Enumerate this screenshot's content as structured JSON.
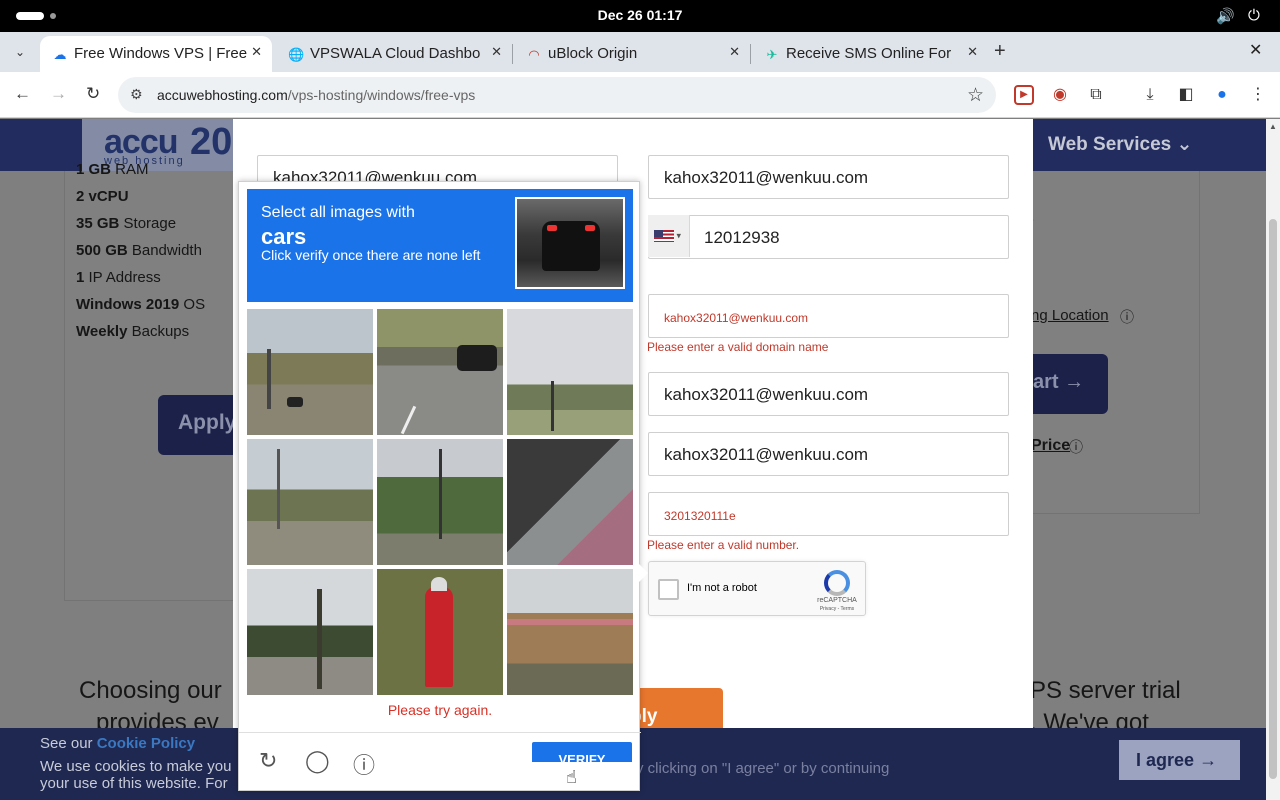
{
  "system": {
    "clock": "Dec 26  01:17",
    "volume_icon": "volume-icon",
    "power_icon": "power-icon"
  },
  "tabs": [
    {
      "title": "Free Windows VPS | Free",
      "close": "✕",
      "icon": "cloud-favicon"
    },
    {
      "title": "VPSWALA Cloud Dashbo",
      "close": "✕",
      "icon": "globe-favicon"
    },
    {
      "title": "uBlock Origin",
      "close": "✕",
      "icon": "rainbow-favicon"
    },
    {
      "title": "Receive SMS Online For",
      "close": "✕",
      "icon": "sms-favicon"
    }
  ],
  "address": {
    "host": "accuwebhosting.com",
    "path": "/vps-hosting/windows/free-vps"
  },
  "site": {
    "logo_text": "accu",
    "logo_num": "20",
    "logo_tag": "web hosting",
    "nav_item": "Web Services",
    "specs": [
      {
        "bold": "1 GB",
        "rest": " RAM"
      },
      {
        "bold": "2 vCPU",
        "rest": ""
      },
      {
        "bold": "35 GB",
        "rest": " Storage"
      },
      {
        "bold": "500 GB",
        "rest": " Bandwidth"
      },
      {
        "bold": "1",
        "rest": " IP Address"
      },
      {
        "bold": "Windows 2019",
        "rest": " OS"
      },
      {
        "bold": "Weekly",
        "rest": " Backups"
      }
    ],
    "apply_left": "Apply",
    "location_link": "ng Location",
    "cart_label": "art",
    "price_link": "Price",
    "trail_char": "e",
    "para_left": "Choosing our",
    "para_left2": "provides ev",
    "para_right": "PS server trial",
    "para_right2": ". We've got"
  },
  "form": {
    "field_top_left": "kahox32011@wenkuu.com",
    "email": "kahox32011@wenkuu.com",
    "phone": "12012938",
    "domain": "kahox32011@wenkuu.com",
    "domain_error": "Please enter a valid domain name",
    "field4": "kahox32011@wenkuu.com",
    "field5": "kahox32011@wenkuu.com",
    "number": "3201320111e",
    "number_error": "Please enter a valid number.",
    "recaptcha_label": "I'm not a robot",
    "recaptcha_brand": "reCAPTCHA",
    "recaptcha_terms": "Privacy - Terms",
    "apply_label": "ply"
  },
  "captcha": {
    "line1": "Select all images with",
    "target": "cars",
    "line3": "Click verify once there are none left",
    "error": "Please try again.",
    "verify": "VERIFY"
  },
  "cookie": {
    "see_our": "See our ",
    "policy": "Cookie Policy",
    "text1": "We use cookies to make you",
    "text2": "your use of this website. For",
    "mid": "y clicking on \"I agree\" or by continuing",
    "agree": "I agree"
  }
}
